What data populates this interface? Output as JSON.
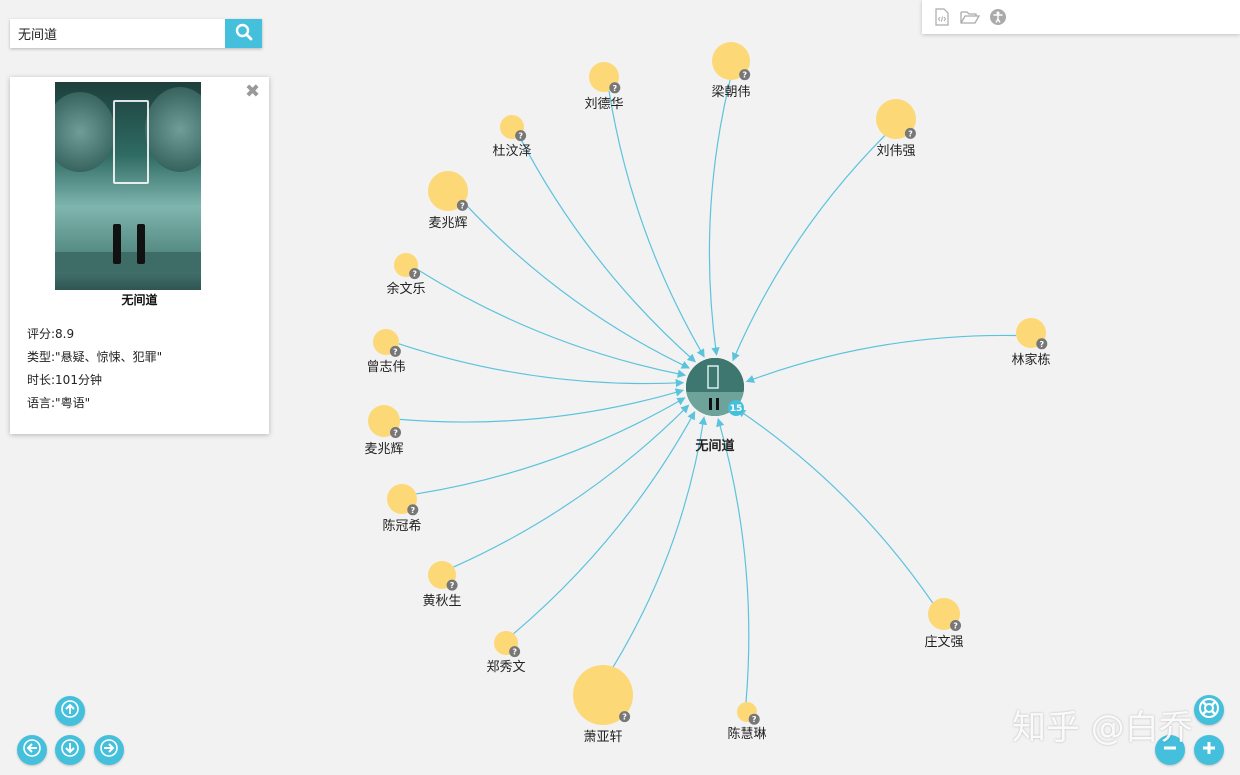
{
  "search": {
    "value": "无间道"
  },
  "info_panel": {
    "title": "无间道",
    "properties": [
      "评分:8.9",
      "类型:\"悬疑、惊悚、犯罪\"",
      "时长:101分钟",
      "语言:\"粤语\""
    ]
  },
  "graph": {
    "center": {
      "label": "无间道",
      "count": "15"
    },
    "nodes": [
      {
        "label": "刘德华"
      },
      {
        "label": "梁朝伟"
      },
      {
        "label": "杜汶泽"
      },
      {
        "label": "刘伟强"
      },
      {
        "label": "麦兆辉"
      },
      {
        "label": "余文乐"
      },
      {
        "label": "曾志伟"
      },
      {
        "label": "麦兆辉"
      },
      {
        "label": "林家栋"
      },
      {
        "label": "陈冠希"
      },
      {
        "label": "黄秋生"
      },
      {
        "label": "郑秀文"
      },
      {
        "label": "萧亚轩"
      },
      {
        "label": "陈慧琳"
      },
      {
        "label": "庄文强"
      }
    ],
    "node_badge": "?",
    "colors": {
      "node": "#fdd877",
      "edge": "#5cc3dd",
      "accent": "#45c0dc"
    }
  },
  "watermark": "知乎 @白乔"
}
